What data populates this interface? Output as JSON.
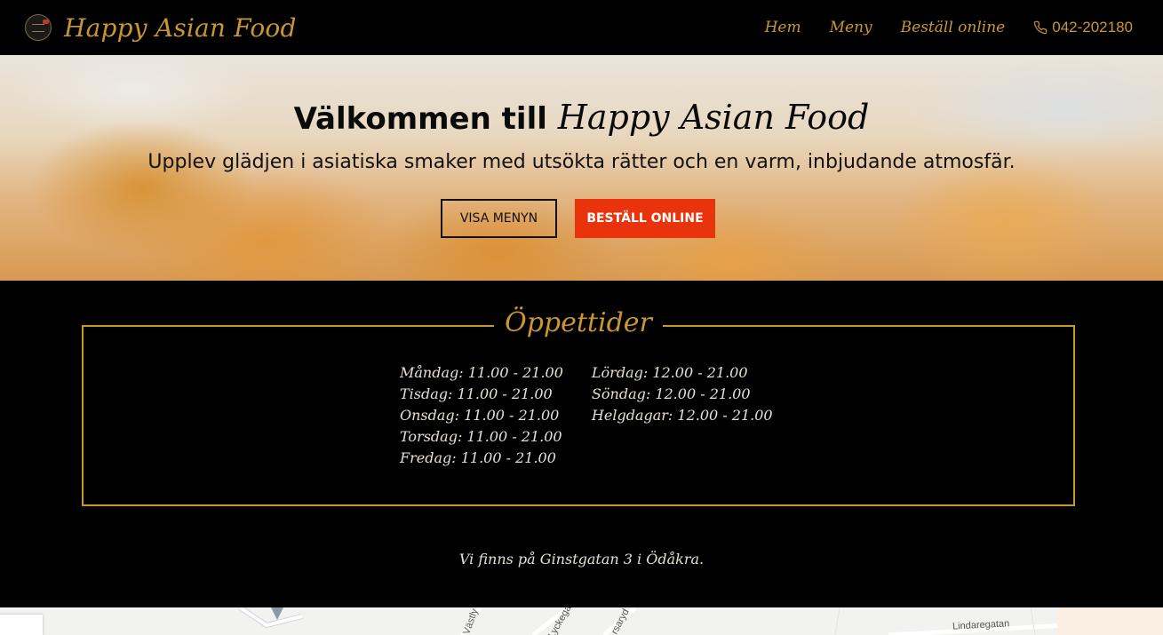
{
  "brand": {
    "name": "Happy Asian Food",
    "logo_icon": "restaurant-logo-icon"
  },
  "nav": {
    "links": [
      {
        "label": "Hem"
      },
      {
        "label": "Meny"
      },
      {
        "label": "Beställ online"
      }
    ],
    "phone": "042-202180",
    "phone_icon": "phone-icon"
  },
  "hero": {
    "title_prefix": "Välkommen till",
    "title_script": "Happy Asian Food",
    "subtitle": "Upplev glädjen i asiatiska smaker med utsökta rätter och en varm, inbjudande atmosfär.",
    "button_menu": "VISA MENYN",
    "button_order": "BESTÄLL ONLINE",
    "order_button_color": "#e8330d"
  },
  "hours": {
    "title": "Öppettider",
    "left": [
      "Måndag: 11.00 - 21.00",
      "Tisdag: 11.00 - 21.00",
      "Onsdag: 11.00 - 21.00",
      "Torsdag: 11.00 - 21.00",
      "Fredag: 11.00 - 21.00"
    ],
    "right": [
      "Lördag: 12.00 - 21.00",
      "Söndag: 12.00 - 21.00",
      "Helgdagar: 12.00 - 21.00"
    ],
    "accent_color": "#c9962f"
  },
  "address": "Vi finns på Ginstgatan 3 i Ödåkra.",
  "map": {
    "labels": [
      "Västly",
      "Lyckega",
      "rsaryd",
      "Lindaregatan"
    ]
  }
}
